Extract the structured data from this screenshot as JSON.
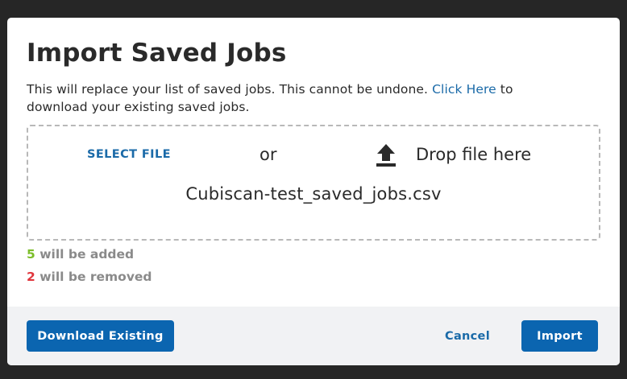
{
  "modal": {
    "title": "Import Saved Jobs",
    "description_text": "This will replace your list of saved jobs. This cannot be undone.",
    "description_link": "Click Here",
    "description_suffix_1": "to",
    "description_suffix_2": "download your existing saved jobs."
  },
  "dropzone": {
    "select_file_label": "SELECT FILE",
    "or_text": "or",
    "upload_icon": "upload-icon",
    "drop_text": "Drop file here",
    "filename": "Cubiscan-test_saved_jobs.csv"
  },
  "summary": {
    "added_count": "5",
    "added_label": "will be added",
    "removed_count": "2",
    "removed_label": "will be removed"
  },
  "footer": {
    "download_label": "Download Existing",
    "cancel_label": "Cancel",
    "import_label": "Import"
  },
  "colors": {
    "accent": "#0b65b0",
    "link": "#1a6aa8",
    "added": "#7cbe2a",
    "removed": "#e0363d"
  }
}
